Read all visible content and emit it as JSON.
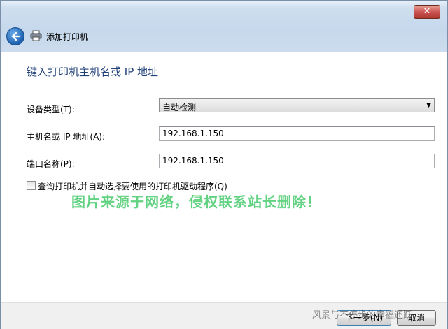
{
  "window": {
    "close_label": "✕"
  },
  "header": {
    "title": "添加打印机"
  },
  "content": {
    "heading": "键入打印机主机名或 IP 地址",
    "device_type": {
      "label": "设备类型(T):",
      "value": "自动检测"
    },
    "hostname": {
      "label": "主机名或 IP 地址(A):",
      "value": "192.168.1.150"
    },
    "port_name": {
      "label": "端口名称(P):",
      "value": "192.168.1.150"
    },
    "query_checkbox": {
      "label": "查询打印机并自动选择要使用的打印机驱动程序(Q)",
      "checked": false
    }
  },
  "watermark": "图片来源于网络，侵权联系站长删除！",
  "footer": {
    "next_label": "下一步(N)",
    "cancel_label": "取消"
  },
  "credit": "风景与不停步的幸福还跃"
}
